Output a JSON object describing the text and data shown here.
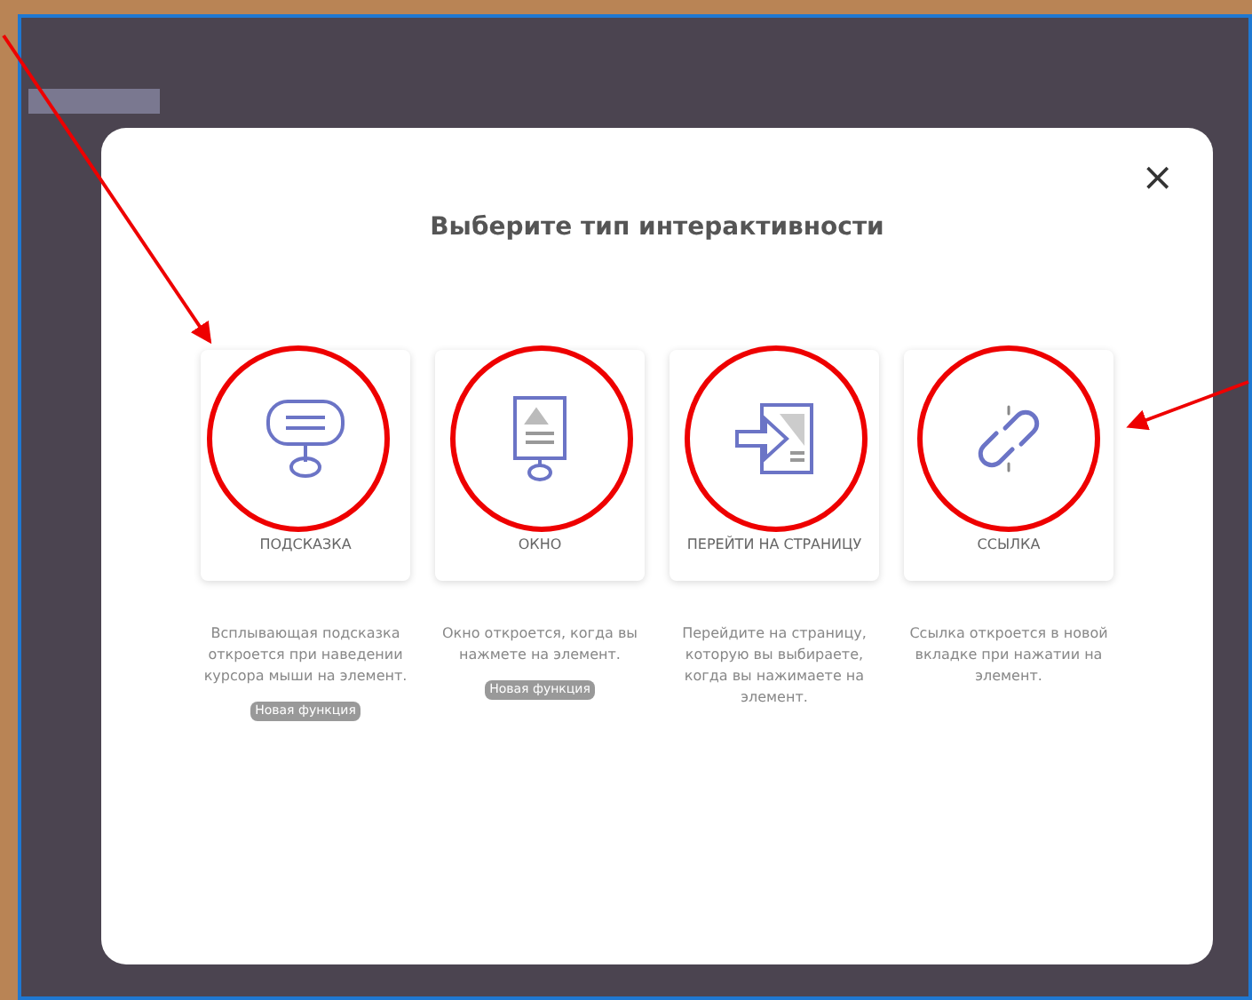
{
  "dialog": {
    "title": "Выберите тип интерактивности",
    "close": "×",
    "options": [
      {
        "kind": "tooltip",
        "label": "ПОДСКАЗКА",
        "description": "Всплывающая подсказка откроется при наведении курсора мыши на элемент.",
        "badge": "Новая функция"
      },
      {
        "kind": "window",
        "label": "ОКНО",
        "description": "Окно откроется, когда вы нажмете на элемент.",
        "badge": "Новая функция"
      },
      {
        "kind": "page",
        "label": "ПЕРЕЙТИ НА СТРАНИЦУ",
        "description": "Перейдите на страницу, которую вы выбираете, когда вы нажимаете на элемент."
      },
      {
        "kind": "link",
        "label": "ССЫЛКА",
        "description": "Ссылка откроется в новой вкладке при нажатии на элемент."
      }
    ]
  }
}
